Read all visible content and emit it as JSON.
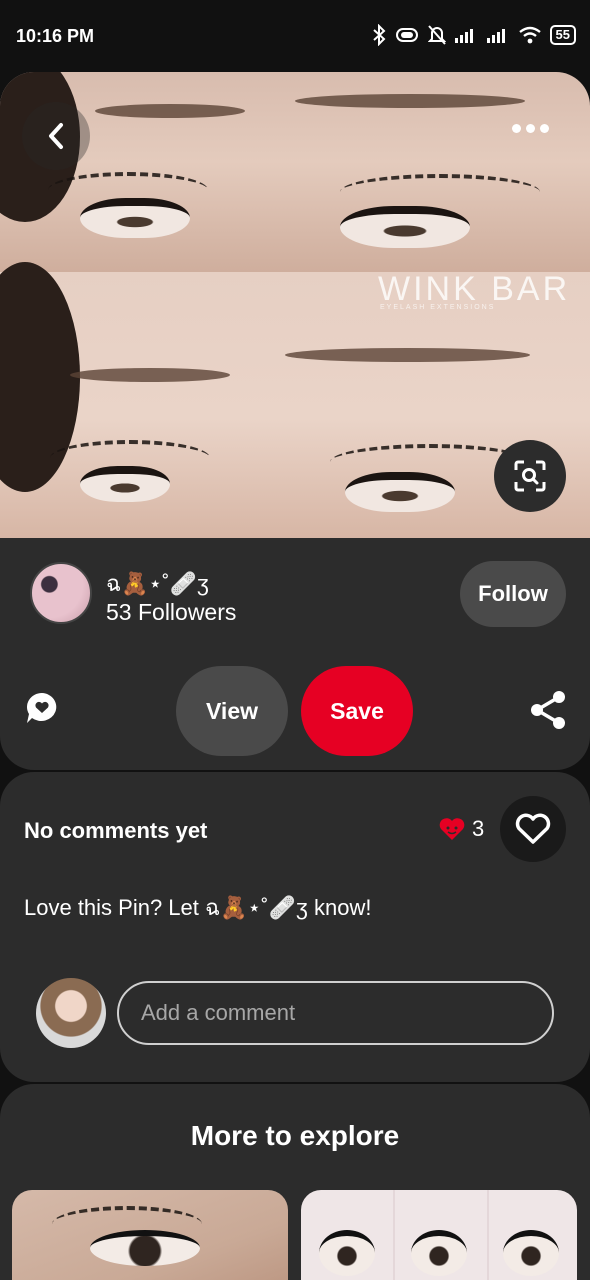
{
  "status_bar": {
    "time": "10:16 PM",
    "battery": "55"
  },
  "pin": {
    "watermark": "WINK BAR",
    "watermark_sub": "EYELASH EXTENSIONS"
  },
  "creator": {
    "name": "ฉ🧸⋆˚🩹ʒ",
    "followers": "53 Followers",
    "follow_label": "Follow"
  },
  "actions": {
    "view_label": "View",
    "save_label": "Save"
  },
  "comments": {
    "title": "No comments yet",
    "reaction_count": "3",
    "invite_text": "Love this Pin? Let ฉ🧸⋆˚🩹ʒ know!",
    "input_placeholder": "Add a comment"
  },
  "explore": {
    "title": "More to explore"
  },
  "colors": {
    "background": "#111111",
    "panel": "#2c2c2c",
    "save_red": "#e60023",
    "secondary_button": "#4a4a4a"
  }
}
